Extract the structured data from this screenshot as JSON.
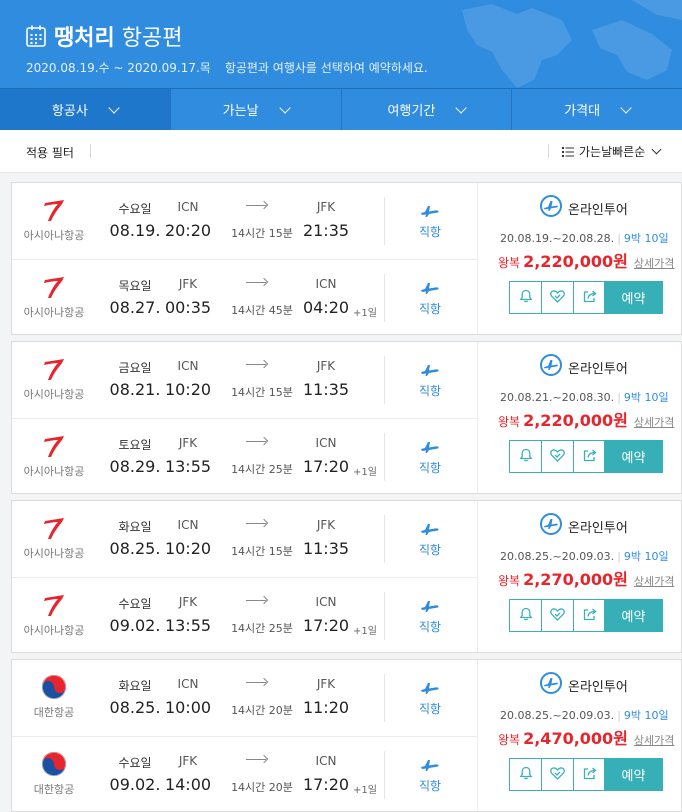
{
  "header": {
    "title_bold": "땡처리",
    "title_rest": " 항공편",
    "date_range": "2020.08.19.수 ~ 2020.09.17.목",
    "description": "항공편과 여행사를 선택하여 예약하세요."
  },
  "tabs": [
    {
      "label": "항공사"
    },
    {
      "label": "가는날"
    },
    {
      "label": "여행기간"
    },
    {
      "label": "가격대"
    }
  ],
  "filter": {
    "label": "적용 필터",
    "sort_label": "가는날빠른순"
  },
  "labels": {
    "book": "예약",
    "detail": "상세가격",
    "direct": "직항"
  },
  "colors": {
    "header_blue": "#2f8cde",
    "price_red": "#e8252c",
    "teal": "#36b0b6"
  },
  "results": [
    {
      "outbound": {
        "airline": "아시아나항공",
        "logo": "asiana-logo",
        "day": "수요일",
        "date": "08.19.",
        "from_code": "ICN",
        "from_time": "20:20",
        "duration": "14시간 15분",
        "to_code": "JFK",
        "to_time": "21:35",
        "plus_day": "",
        "direct": "직항"
      },
      "inbound": {
        "airline": "아시아나항공",
        "logo": "asiana-logo",
        "day": "목요일",
        "date": "08.27.",
        "from_code": "JFK",
        "from_time": "00:35",
        "duration": "14시간 45분",
        "to_code": "ICN",
        "to_time": "04:20",
        "plus_day": "+1일",
        "direct": "직항"
      },
      "agency": "온라인투어",
      "period": "20.08.19.~20.08.28.",
      "nights": "9박 10일",
      "price_label": "왕복",
      "price": "2,220,000원"
    },
    {
      "outbound": {
        "airline": "아시아나항공",
        "logo": "asiana-logo",
        "day": "금요일",
        "date": "08.21.",
        "from_code": "ICN",
        "from_time": "10:20",
        "duration": "14시간 15분",
        "to_code": "JFK",
        "to_time": "11:35",
        "plus_day": "",
        "direct": "직항"
      },
      "inbound": {
        "airline": "아시아나항공",
        "logo": "asiana-logo",
        "day": "토요일",
        "date": "08.29.",
        "from_code": "JFK",
        "from_time": "13:55",
        "duration": "14시간 25분",
        "to_code": "ICN",
        "to_time": "17:20",
        "plus_day": "+1일",
        "direct": "직항"
      },
      "agency": "온라인투어",
      "period": "20.08.21.~20.08.30.",
      "nights": "9박 10일",
      "price_label": "왕복",
      "price": "2,220,000원"
    },
    {
      "outbound": {
        "airline": "아시아나항공",
        "logo": "asiana-logo",
        "day": "화요일",
        "date": "08.25.",
        "from_code": "ICN",
        "from_time": "10:20",
        "duration": "14시간 15분",
        "to_code": "JFK",
        "to_time": "11:35",
        "plus_day": "",
        "direct": "직항"
      },
      "inbound": {
        "airline": "아시아나항공",
        "logo": "asiana-logo",
        "day": "수요일",
        "date": "09.02.",
        "from_code": "JFK",
        "from_time": "13:55",
        "duration": "14시간 25분",
        "to_code": "ICN",
        "to_time": "17:20",
        "plus_day": "+1일",
        "direct": "직항"
      },
      "agency": "온라인투어",
      "period": "20.08.25.~20.09.03.",
      "nights": "9박 10일",
      "price_label": "왕복",
      "price": "2,270,000원"
    },
    {
      "outbound": {
        "airline": "대한항공",
        "logo": "korean-air-logo",
        "day": "화요일",
        "date": "08.25.",
        "from_code": "ICN",
        "from_time": "10:00",
        "duration": "14시간 20분",
        "to_code": "JFK",
        "to_time": "11:20",
        "plus_day": "",
        "direct": "직항"
      },
      "inbound": {
        "airline": "대한항공",
        "logo": "korean-air-logo",
        "day": "수요일",
        "date": "09.02.",
        "from_code": "JFK",
        "from_time": "14:00",
        "duration": "14시간 20분",
        "to_code": "ICN",
        "to_time": "17:20",
        "plus_day": "+1일",
        "direct": "직항"
      },
      "agency": "온라인투어",
      "period": "20.08.25.~20.09.03.",
      "nights": "9박 10일",
      "price_label": "왕복",
      "price": "2,470,000원"
    }
  ]
}
